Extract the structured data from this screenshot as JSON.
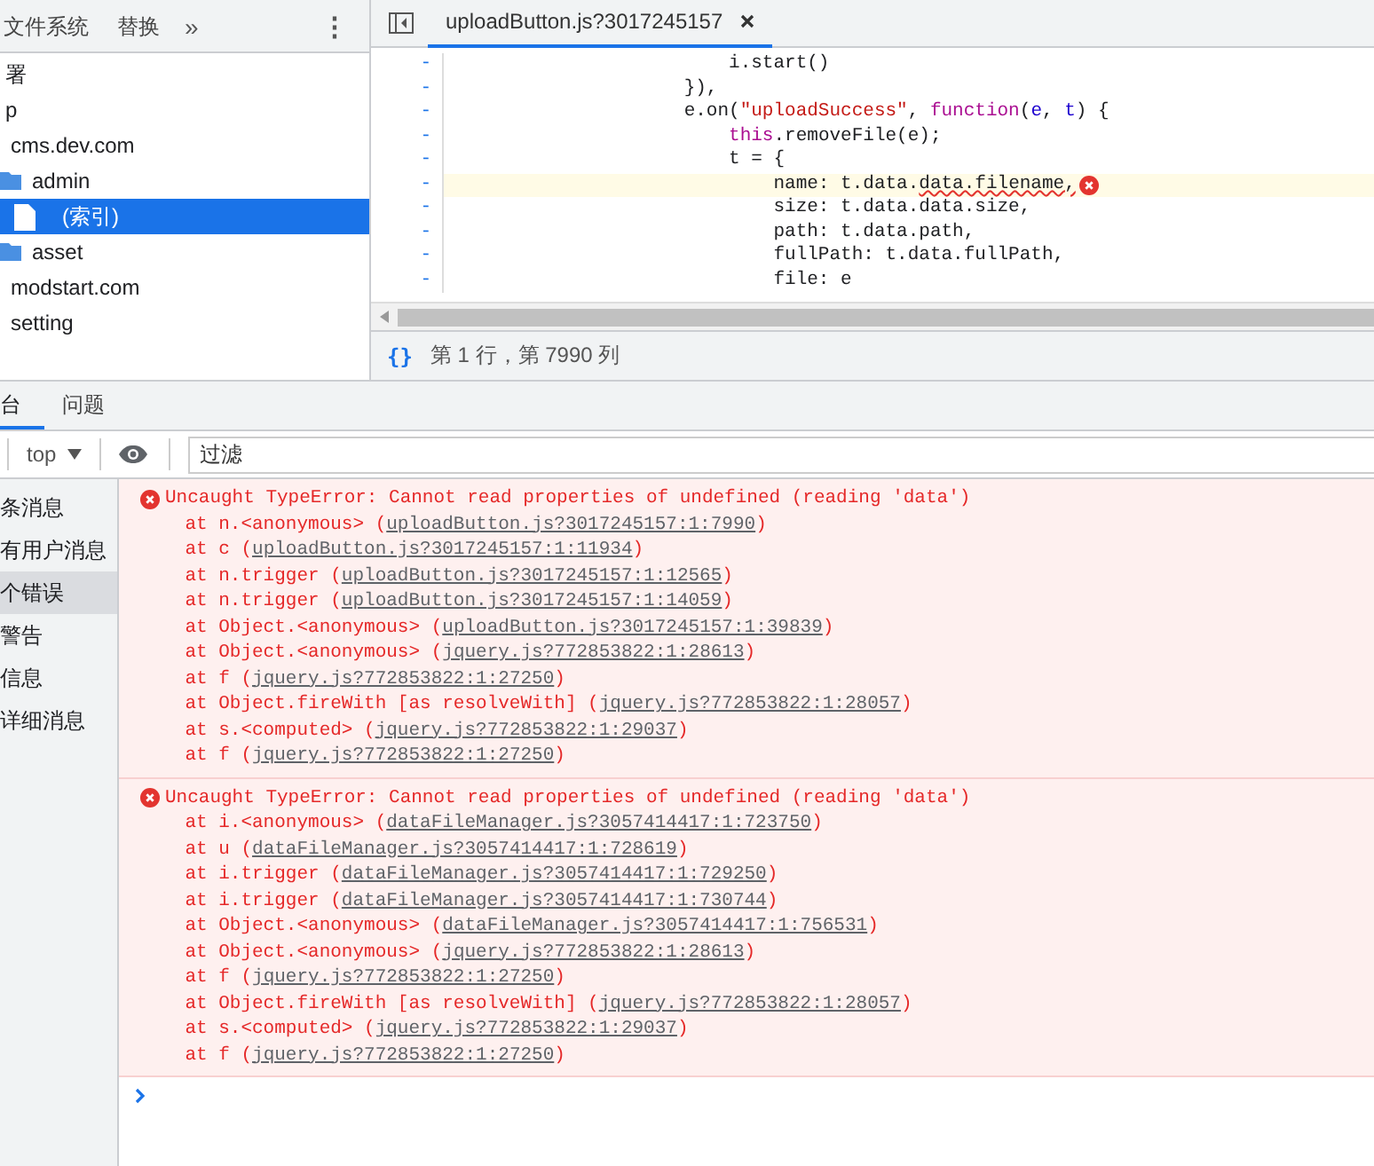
{
  "navigator": {
    "tabs": [
      {
        "label": "文件系统",
        "selected": false
      },
      {
        "label": "替换",
        "selected": false
      }
    ],
    "more": "»",
    "menu": "⋮",
    "tree": [
      {
        "label": "署",
        "selected": false,
        "children": [
          {
            "label": "p",
            "selected": false,
            "children": [
              {
                "label": "cms.dev.com",
                "selected": false,
                "children": [
                  {
                    "label": "admin",
                    "kind": "folder",
                    "selected": false,
                    "children": [
                      {
                        "label": "(索引)",
                        "kind": "file",
                        "selected": true
                      }
                    ]
                  },
                  {
                    "label": "asset",
                    "kind": "folder",
                    "selected": false
                  }
                ]
              },
              {
                "label": "modstart.com",
                "selected": false
              },
              {
                "label": "setting",
                "selected": false
              }
            ]
          }
        ]
      }
    ]
  },
  "editor": {
    "tabs": [
      {
        "label": "uploadButton.js?3017245157",
        "selected": true
      }
    ],
    "lines": [
      {
        "marker": "-",
        "highlighted": false,
        "error": false,
        "tokens": [
          {
            "kind": "plain",
            "text": "                         i.start()"
          }
        ]
      },
      {
        "marker": "-",
        "highlighted": false,
        "error": false,
        "tokens": [
          {
            "kind": "plain",
            "text": "                     }),"
          }
        ]
      },
      {
        "marker": "-",
        "highlighted": false,
        "error": false,
        "tokens": [
          {
            "kind": "plain",
            "text": "                     e.on("
          },
          {
            "kind": "string",
            "text": "\"uploadSuccess\""
          },
          {
            "kind": "plain",
            "text": ", "
          },
          {
            "kind": "keyword",
            "text": "function"
          },
          {
            "kind": "plain",
            "text": "("
          },
          {
            "kind": "param",
            "text": "e"
          },
          {
            "kind": "plain",
            "text": ", "
          },
          {
            "kind": "param",
            "text": "t"
          },
          {
            "kind": "plain",
            "text": ") {"
          }
        ]
      },
      {
        "marker": "-",
        "highlighted": false,
        "error": false,
        "tokens": [
          {
            "kind": "keyword",
            "text": "                         this"
          },
          {
            "kind": "plain",
            "text": ".removeFile(e);"
          }
        ]
      },
      {
        "marker": "-",
        "highlighted": false,
        "error": false,
        "tokens": [
          {
            "kind": "plain",
            "text": "                         t = {"
          }
        ]
      },
      {
        "marker": "-",
        "highlighted": true,
        "error": true,
        "tokens": [
          {
            "kind": "plain",
            "text": "                             name: t.data."
          },
          {
            "kind": "squiggle",
            "text": "data.filename,"
          }
        ]
      },
      {
        "marker": "-",
        "highlighted": false,
        "error": false,
        "tokens": [
          {
            "kind": "plain",
            "text": "                             size: t.data.data.size,"
          }
        ]
      },
      {
        "marker": "-",
        "highlighted": false,
        "error": false,
        "tokens": [
          {
            "kind": "plain",
            "text": "                             path: t.data.path,"
          }
        ]
      },
      {
        "marker": "-",
        "highlighted": false,
        "error": false,
        "tokens": [
          {
            "kind": "plain",
            "text": "                             fullPath: t.data.fullPath,"
          }
        ]
      },
      {
        "marker": "-",
        "highlighted": false,
        "error": false,
        "tokens": [
          {
            "kind": "plain",
            "text": "                             file: e"
          }
        ]
      }
    ],
    "status": {
      "format_button": "{}",
      "position": "第 1 行，第 7990 列"
    }
  },
  "console": {
    "tabs": [
      {
        "label": "台",
        "selected": true
      },
      {
        "label": "问题",
        "selected": false
      }
    ],
    "context": "top",
    "filter": {
      "placeholder": "过滤"
    },
    "sidebar": [
      {
        "label": "条消息",
        "selected": false
      },
      {
        "label": "有用户消息",
        "selected": false
      },
      {
        "label": "个错误",
        "selected": true
      },
      {
        "label": "警告",
        "selected": false
      },
      {
        "label": "信息",
        "selected": false
      },
      {
        "label": "详细消息",
        "selected": false
      }
    ],
    "messages": [
      {
        "kind": "error",
        "text": "Uncaught TypeError: Cannot read properties of undefined (reading 'data')",
        "frames": [
          {
            "prefix": "    at n.<anonymous> (",
            "link": "uploadButton.js?3017245157:1:7990",
            "suffix": ")"
          },
          {
            "prefix": "    at c (",
            "link": "uploadButton.js?3017245157:1:11934",
            "suffix": ")"
          },
          {
            "prefix": "    at n.trigger (",
            "link": "uploadButton.js?3017245157:1:12565",
            "suffix": ")"
          },
          {
            "prefix": "    at n.trigger (",
            "link": "uploadButton.js?3017245157:1:14059",
            "suffix": ")"
          },
          {
            "prefix": "    at Object.<anonymous> (",
            "link": "uploadButton.js?3017245157:1:39839",
            "suffix": ")"
          },
          {
            "prefix": "    at Object.<anonymous> (",
            "link": "jquery.js?772853822:1:28613",
            "suffix": ")"
          },
          {
            "prefix": "    at f (",
            "link": "jquery.js?772853822:1:27250",
            "suffix": ")"
          },
          {
            "prefix": "    at Object.fireWith [as resolveWith] (",
            "link": "jquery.js?772853822:1:28057",
            "suffix": ")"
          },
          {
            "prefix": "    at s.<computed> (",
            "link": "jquery.js?772853822:1:29037",
            "suffix": ")"
          },
          {
            "prefix": "    at f (",
            "link": "jquery.js?772853822:1:27250",
            "suffix": ")"
          }
        ]
      },
      {
        "kind": "error",
        "text": "Uncaught TypeError: Cannot read properties of undefined (reading 'data')",
        "frames": [
          {
            "prefix": "    at i.<anonymous> (",
            "link": "dataFileManager.js?3057414417:1:723750",
            "suffix": ")"
          },
          {
            "prefix": "    at u (",
            "link": "dataFileManager.js?3057414417:1:728619",
            "suffix": ")"
          },
          {
            "prefix": "    at i.trigger (",
            "link": "dataFileManager.js?3057414417:1:729250",
            "suffix": ")"
          },
          {
            "prefix": "    at i.trigger (",
            "link": "dataFileManager.js?3057414417:1:730744",
            "suffix": ")"
          },
          {
            "prefix": "    at Object.<anonymous> (",
            "link": "dataFileManager.js?3057414417:1:756531",
            "suffix": ")"
          },
          {
            "prefix": "    at Object.<anonymous> (",
            "link": "jquery.js?772853822:1:28613",
            "suffix": ")"
          },
          {
            "prefix": "    at f (",
            "link": "jquery.js?772853822:1:27250",
            "suffix": ")"
          },
          {
            "prefix": "    at Object.fireWith [as resolveWith] (",
            "link": "jquery.js?772853822:1:28057",
            "suffix": ")"
          },
          {
            "prefix": "    at s.<computed> (",
            "link": "jquery.js?772853822:1:29037",
            "suffix": ")"
          },
          {
            "prefix": "    at f (",
            "link": "jquery.js?772853822:1:27250",
            "suffix": ")"
          }
        ]
      }
    ]
  }
}
